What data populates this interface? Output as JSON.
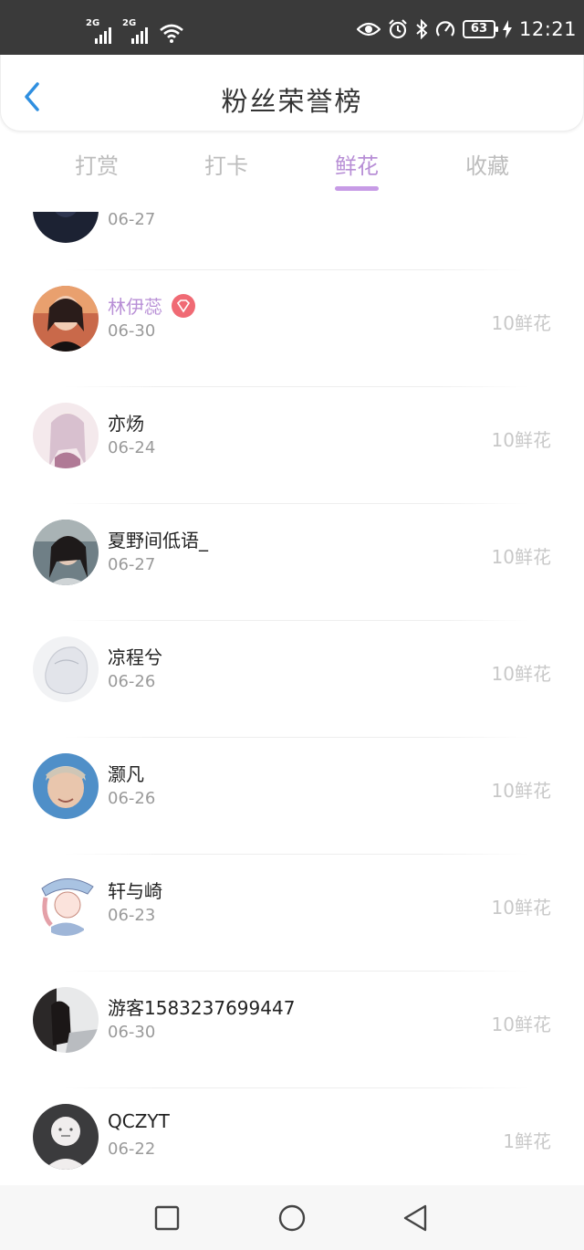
{
  "status_bar": {
    "sim1": "2G",
    "sim2": "2G",
    "battery": "63",
    "time": "12:21",
    "icons": [
      "signal-icon",
      "wifi-icon",
      "eye-icon",
      "alarm-icon",
      "bluetooth-icon",
      "speed-icon",
      "battery-icon",
      "charging-icon"
    ]
  },
  "header": {
    "title": "粉丝荣誉榜",
    "back_icon": "back-arrow-icon"
  },
  "tabs": [
    {
      "label": "打赏",
      "active": false
    },
    {
      "label": "打卡",
      "active": false
    },
    {
      "label": "鲜花",
      "active": true
    },
    {
      "label": "收藏",
      "active": false
    }
  ],
  "accent_color": "#b88fd6",
  "fans": [
    {
      "name": "",
      "date": "06-27",
      "amount": ""
    },
    {
      "name": "林伊蕊",
      "date": "06-30",
      "amount": "10鲜花",
      "vip": true
    },
    {
      "name": "亦炀",
      "date": "06-24",
      "amount": "10鲜花"
    },
    {
      "name": "夏野间低语_",
      "date": "06-27",
      "amount": "10鲜花"
    },
    {
      "name": "凉程兮",
      "date": "06-26",
      "amount": "10鲜花"
    },
    {
      "name": "灏凡",
      "date": "06-26",
      "amount": "10鲜花"
    },
    {
      "name": "轩与崎",
      "date": "06-23",
      "amount": "10鲜花"
    },
    {
      "name": "游客1583237699447",
      "date": "06-30",
      "amount": "10鲜花"
    },
    {
      "name": "QCZYT",
      "date": "06-22",
      "amount": "1鲜花"
    }
  ],
  "navbar": {
    "icons": [
      "recent-apps-icon",
      "home-icon",
      "back-icon"
    ]
  }
}
